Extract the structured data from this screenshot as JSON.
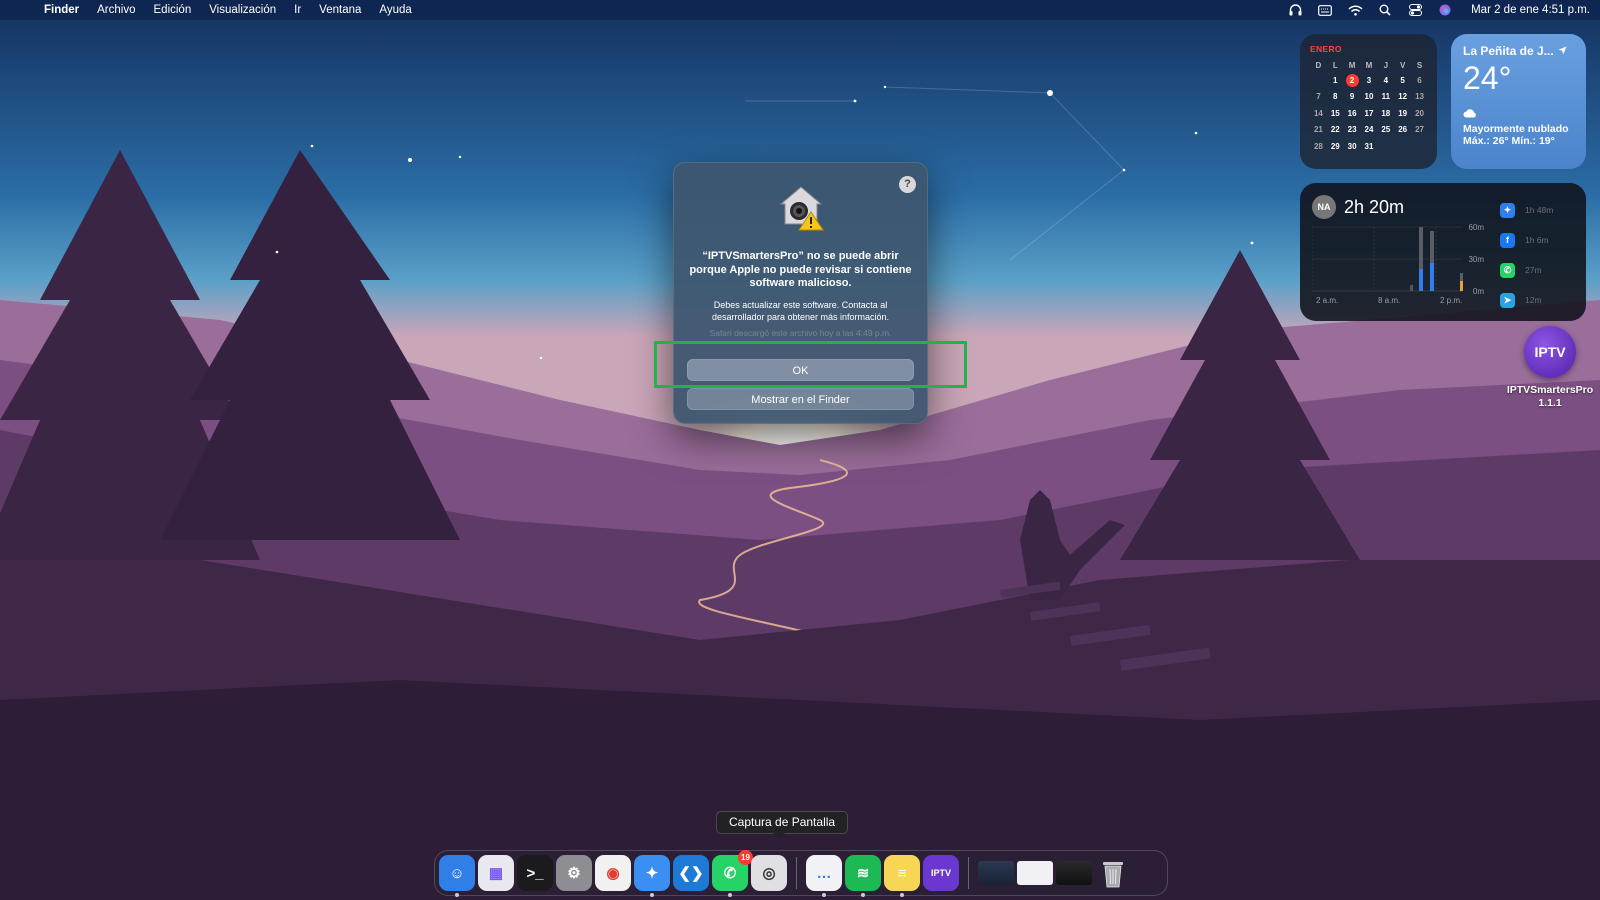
{
  "menubar": {
    "app_name": "Finder",
    "items": [
      "Archivo",
      "Edición",
      "Visualización",
      "Ir",
      "Ventana",
      "Ayuda"
    ],
    "status_icons": [
      "headphones-icon",
      "keyboard-icon",
      "wifi-icon",
      "search-icon",
      "control-center-icon",
      "siri-icon"
    ],
    "clock": "Mar 2 de ene  4:51 p.m."
  },
  "calendar_widget": {
    "month": "ENERO",
    "weekdays": [
      "D",
      "L",
      "M",
      "M",
      "J",
      "V",
      "S"
    ],
    "weeks": [
      [
        "",
        "1",
        "2",
        "3",
        "4",
        "5",
        "6"
      ],
      [
        "7",
        "8",
        "9",
        "10",
        "11",
        "12",
        "13"
      ],
      [
        "14",
        "15",
        "16",
        "17",
        "18",
        "19",
        "20"
      ],
      [
        "21",
        "22",
        "23",
        "24",
        "25",
        "26",
        "27"
      ],
      [
        "28",
        "29",
        "30",
        "31",
        "",
        "",
        ""
      ]
    ],
    "today": "2",
    "today_color": "#ff3b30"
  },
  "weather_widget": {
    "location": "La Peñita de J...",
    "temperature": "24°",
    "condition": "Mayormente nublado",
    "hi_lo": "Máx.: 26° Mín.: 19°"
  },
  "screentime_widget": {
    "avatar": "NA",
    "total": "2h 20m",
    "y_ticks": [
      "60m",
      "30m",
      "0m"
    ],
    "x_ticks": [
      "2 a.m.",
      "8 a.m.",
      "2 p.m."
    ],
    "apps": [
      {
        "icon": "safari-icon",
        "time": "1h 48m",
        "color": "#2f7ff0"
      },
      {
        "icon": "facebook-icon",
        "time": "1h 6m",
        "color": "#1877f2"
      },
      {
        "icon": "whatsapp-icon",
        "time": "27m",
        "color": "#25d366"
      },
      {
        "icon": "telegram-icon",
        "time": "12m",
        "color": "#2aa3e0"
      }
    ]
  },
  "desktop_icon": {
    "label_line1": "IPTVSmartersPro",
    "label_line2": "1.1.1",
    "logo_text": "IPTV"
  },
  "dialog": {
    "title": "“IPTVSmartersPro” no se puede abrir porque Apple no puede revisar si contiene software malicioso.",
    "message": "Debes actualizar este software. Contacta al desarrollador para obtener más información.",
    "faded_text": "Safari descargó este archivo hoy a las 4:49 p.m.",
    "ok_label": "OK",
    "finder_label": "Mostrar en el Finder",
    "help_label": "?"
  },
  "tooltip": {
    "text": "Captura de Pantalla"
  },
  "dock": {
    "apps": [
      {
        "name": "finder",
        "glyph": "☺",
        "bg": "#2f7fe6",
        "running": true
      },
      {
        "name": "launchpad",
        "glyph": "▦",
        "bg": "#e8e8ee",
        "fg": "#7a5af5",
        "running": false
      },
      {
        "name": "terminal",
        "glyph": ">_",
        "bg": "#1b1b1d",
        "running": false
      },
      {
        "name": "system-settings",
        "glyph": "⚙",
        "bg": "#8d8d93",
        "running": false
      },
      {
        "name": "chrome",
        "glyph": "◉",
        "bg": "#f1f1f1",
        "fg": "#e33b2e",
        "running": false
      },
      {
        "name": "safari",
        "glyph": "✦",
        "bg": "#3b8ef2",
        "running": true
      },
      {
        "name": "vscode",
        "glyph": "❮❯",
        "bg": "#1e7ad6",
        "running": false
      },
      {
        "name": "whatsapp",
        "glyph": "✆",
        "bg": "#25d366",
        "running": true,
        "badge": "19"
      },
      {
        "name": "screenshot",
        "glyph": "◎",
        "bg": "#e0e0e4",
        "fg": "#333",
        "running": false
      }
    ],
    "apps2": [
      {
        "name": "messages",
        "glyph": "…",
        "bg": "#f2f2f6",
        "fg": "#2f7ff0",
        "running": true
      },
      {
        "name": "spotify",
        "glyph": "≋",
        "bg": "#1db954",
        "running": true
      },
      {
        "name": "notes",
        "glyph": "≡",
        "bg": "#f7d655",
        "fg": "#fff",
        "running": true
      },
      {
        "name": "iptv",
        "glyph": "IPTV",
        "bg": "#6a38cf",
        "running": false
      }
    ]
  }
}
